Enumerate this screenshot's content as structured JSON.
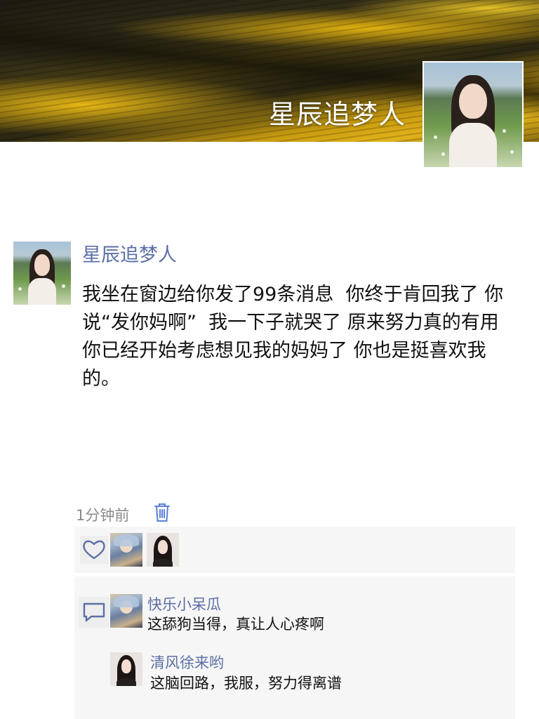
{
  "profile": {
    "cover_name": "星辰追梦人"
  },
  "post": {
    "author": "星辰追梦人",
    "text": "我坐在窗边给你发了99条消息  你终于肯回我了 你说“发你妈啊”  我一下子就哭了 原来努力真的有用  你已经开始考虑想见我的妈妈了 你也是挺喜欢我的。",
    "time": "1分钟前"
  },
  "likes": {
    "count": 2
  },
  "comments": [
    {
      "author": "快乐小呆瓜",
      "text": "这舔狗当得，真让人心疼啊"
    },
    {
      "author": "清风徐来哟",
      "text": "这脑回路，我服，努力得离谱"
    }
  ],
  "colors": {
    "name_blue": "#5b6fa5",
    "icon_blue": "#5b7fd6",
    "panel_bg": "#f6f6f6",
    "time_gray": "#8a8a8a"
  },
  "icons": {
    "delete": "trash-icon",
    "like": "heart-icon",
    "comment": "comment-icon"
  }
}
